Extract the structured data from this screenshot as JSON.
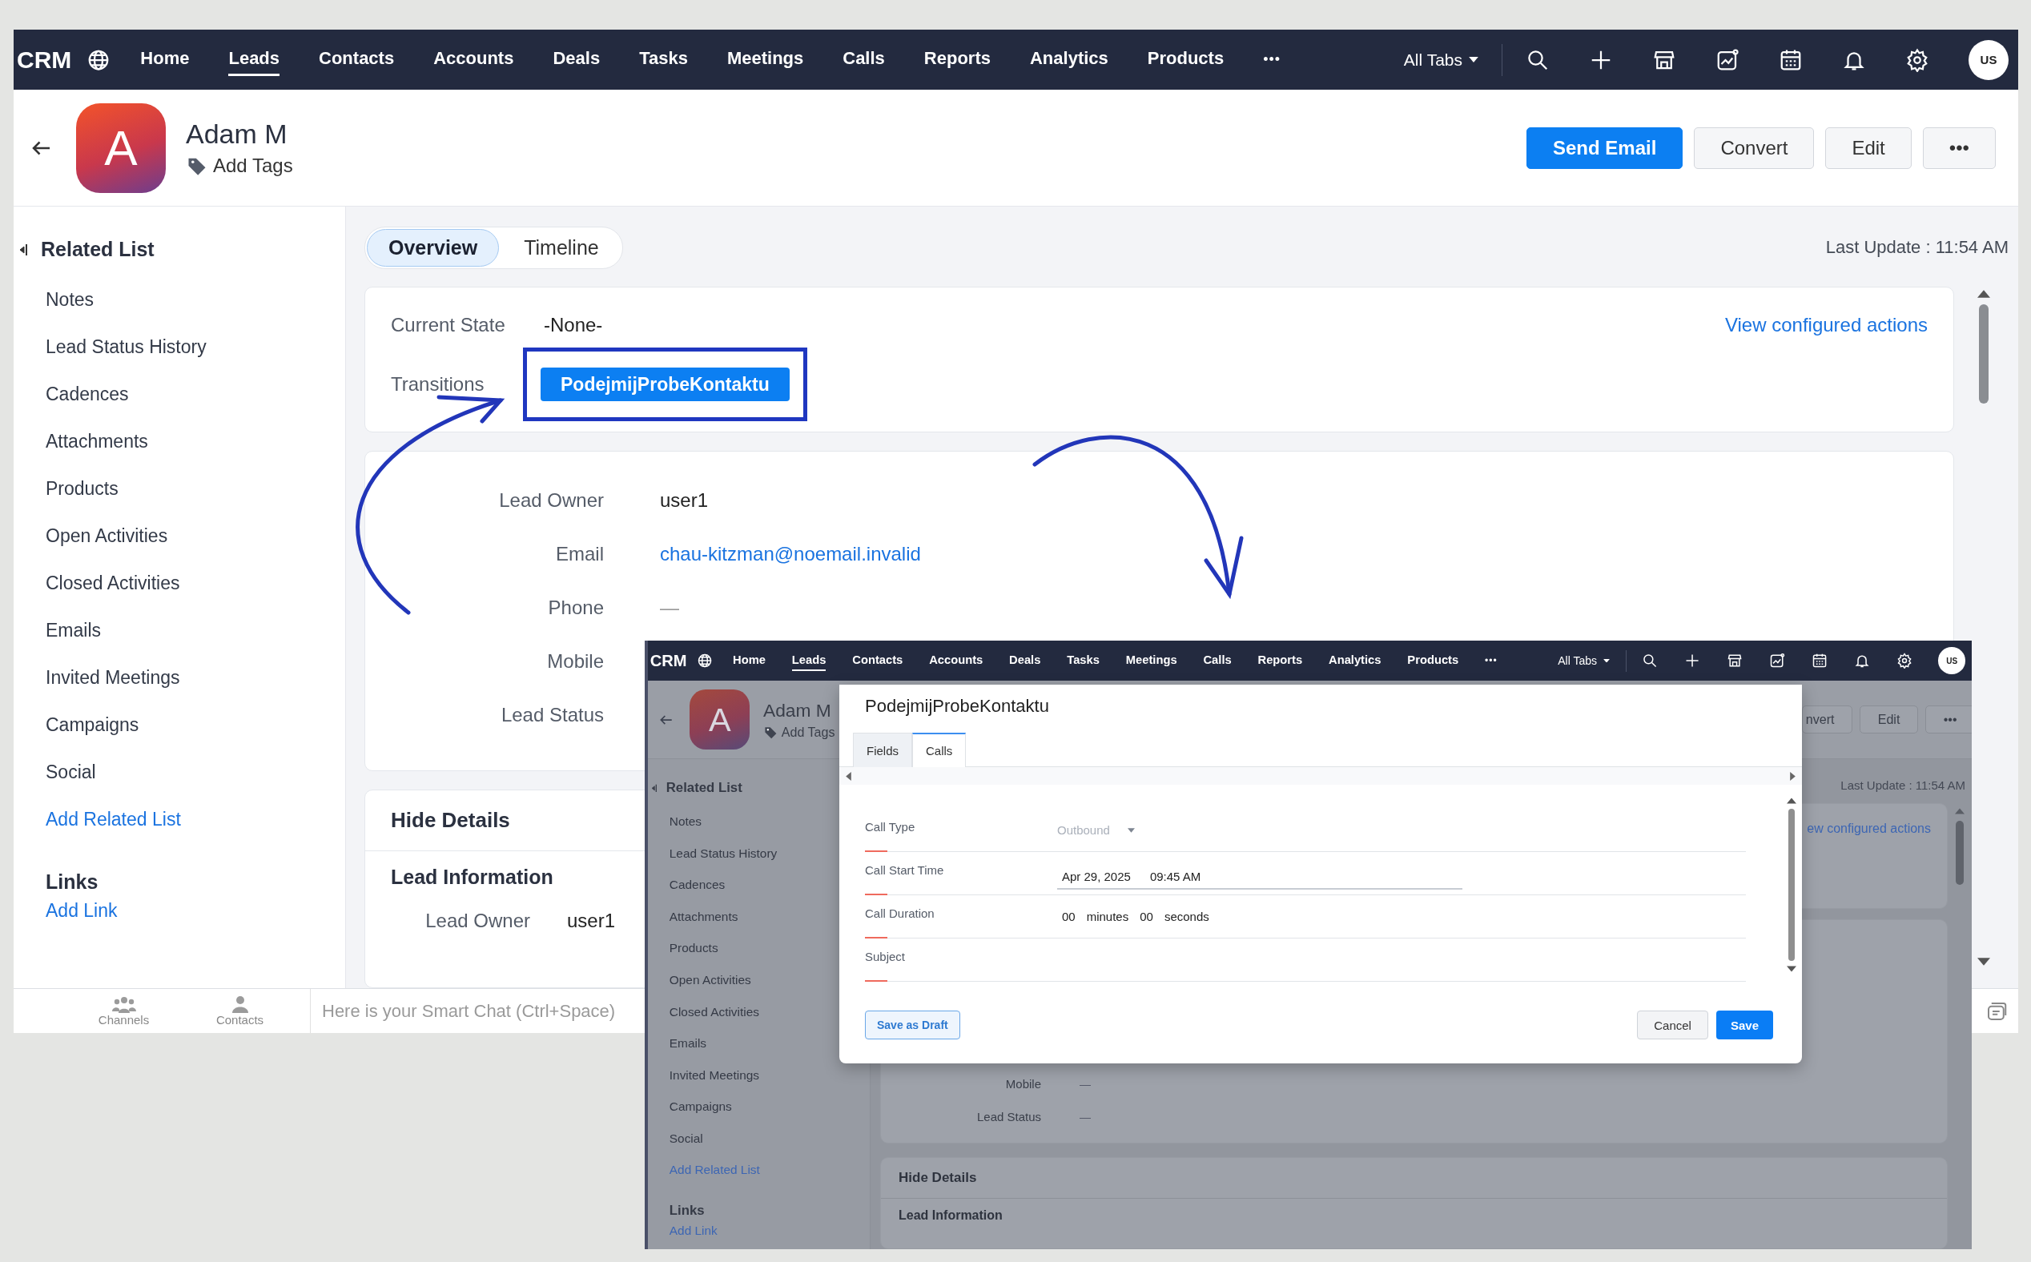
{
  "nav": {
    "logo": "CRM",
    "items": [
      {
        "label": "Home",
        "selected": false
      },
      {
        "label": "Leads",
        "selected": true
      },
      {
        "label": "Contacts",
        "selected": false
      },
      {
        "label": "Accounts",
        "selected": false
      },
      {
        "label": "Deals",
        "selected": false
      },
      {
        "label": "Tasks",
        "selected": false
      },
      {
        "label": "Meetings",
        "selected": false
      },
      {
        "label": "Calls",
        "selected": false
      },
      {
        "label": "Reports",
        "selected": false
      },
      {
        "label": "Analytics",
        "selected": false
      },
      {
        "label": "Products",
        "selected": false
      }
    ],
    "more": "•••",
    "all_tabs": "All Tabs",
    "avatar": "US"
  },
  "record": {
    "initial": "A",
    "name": "Adam M",
    "add_tags": "Add Tags"
  },
  "actions": [
    {
      "label": "Send Email",
      "kind": "primary"
    },
    {
      "label": "Convert",
      "kind": "secondary"
    },
    {
      "label": "Edit",
      "kind": "secondary"
    },
    {
      "label": "•••",
      "kind": "secondary"
    }
  ],
  "sidebar": {
    "title": "Related List",
    "items": [
      {
        "label": "Notes",
        "kind": "item"
      },
      {
        "label": "Lead Status History",
        "kind": "item"
      },
      {
        "label": "Cadences",
        "kind": "item"
      },
      {
        "label": "Attachments",
        "kind": "item"
      },
      {
        "label": "Products",
        "kind": "item"
      },
      {
        "label": "Open Activities",
        "kind": "item"
      },
      {
        "label": "Closed Activities",
        "kind": "item"
      },
      {
        "label": "Emails",
        "kind": "item"
      },
      {
        "label": "Invited Meetings",
        "kind": "item"
      },
      {
        "label": "Campaigns",
        "kind": "item"
      },
      {
        "label": "Social",
        "kind": "item"
      },
      {
        "label": "Add Related List",
        "kind": "link"
      }
    ],
    "links_title": "Links",
    "add_link": "Add Link"
  },
  "view_tabs": [
    {
      "label": "Overview",
      "selected": true
    },
    {
      "label": "Timeline",
      "selected": false
    }
  ],
  "last_update": "Last Update : 11:54 AM",
  "blueprint": {
    "current_state_label": "Current State",
    "current_state": "-None-",
    "view_actions": "View configured actions",
    "transitions_label": "Transitions",
    "transition": "PodejmijProbeKontaktu",
    "highlighted": true
  },
  "details": [
    {
      "label": "Lead Owner",
      "value": "user1",
      "kind": "text"
    },
    {
      "label": "Email",
      "value": "chau-kitzman@noemail.invalid",
      "kind": "link"
    },
    {
      "label": "Phone",
      "value": "—",
      "kind": "empty"
    },
    {
      "label": "Mobile"
    },
    {
      "label": "Lead Status"
    }
  ],
  "hide_details": "Hide Details",
  "lead_information": "Lead Information",
  "info_rows": [
    {
      "label": "Lead Owner",
      "value": "user1"
    }
  ],
  "chat_bar": {
    "tabs": [
      {
        "label": "Channels",
        "kind": "group"
      },
      {
        "label": "Contacts",
        "kind": "person"
      }
    ],
    "placeholder": "Here is your Smart Chat (Ctrl+Space)"
  },
  "inset": {
    "nav": {
      "logo": "CRM",
      "items": [
        {
          "label": "Home",
          "selected": false
        },
        {
          "label": "Leads",
          "selected": true
        },
        {
          "label": "Contacts",
          "selected": false
        },
        {
          "label": "Accounts",
          "selected": false
        },
        {
          "label": "Deals",
          "selected": false
        },
        {
          "label": "Tasks",
          "selected": false
        },
        {
          "label": "Meetings",
          "selected": false
        },
        {
          "label": "Calls",
          "selected": false
        },
        {
          "label": "Reports",
          "selected": false
        },
        {
          "label": "Analytics",
          "selected": false
        },
        {
          "label": "Products",
          "selected": false
        }
      ],
      "more": "•••",
      "all_tabs": "All Tabs",
      "avatar": "US"
    },
    "record": {
      "initial": "A",
      "name": "Adam M",
      "add_tags": "Add Tags"
    },
    "actions": [
      {
        "label": "nvert",
        "kind": "secondary"
      },
      {
        "label": "Edit",
        "kind": "secondary"
      },
      {
        "label": "•••",
        "kind": "secondary"
      }
    ],
    "sidebar": {
      "title": "Related List",
      "items": [
        {
          "label": "Notes",
          "kind": "item"
        },
        {
          "label": "Lead Status History",
          "kind": "item"
        },
        {
          "label": "Cadences",
          "kind": "item"
        },
        {
          "label": "Attachments",
          "kind": "item"
        },
        {
          "label": "Products",
          "kind": "item"
        },
        {
          "label": "Open Activities",
          "kind": "item"
        },
        {
          "label": "Closed Activities",
          "kind": "item"
        },
        {
          "label": "Emails",
          "kind": "item"
        },
        {
          "label": "Invited Meetings",
          "kind": "item"
        },
        {
          "label": "Campaigns",
          "kind": "item"
        },
        {
          "label": "Social",
          "kind": "item"
        },
        {
          "label": "Add Related List",
          "kind": "link"
        }
      ],
      "links_title": "Links",
      "add_link": "Add Link"
    },
    "last_update": "Last Update : 11:54 AM",
    "view_actions": "ew configured actions",
    "details": [
      {
        "label": "Mobile",
        "value": "—"
      },
      {
        "label": "Lead Status",
        "value": "—"
      }
    ],
    "hide_details": "Hide Details",
    "lead_information": "Lead Information",
    "dialog": {
      "title": "PodejmijProbeKontaktu",
      "tabs": [
        {
          "label": "Fields",
          "selected": false
        },
        {
          "label": "Calls",
          "selected": true
        }
      ],
      "fields": [
        {
          "label": "Call Type",
          "kind": "select",
          "required": true,
          "placeholder": "Outbound"
        },
        {
          "label": "Call Start Time",
          "kind": "datetime",
          "required": true,
          "date": "Apr 29, 2025",
          "time": "09:45 AM"
        },
        {
          "label": "Call Duration",
          "kind": "duration",
          "required": true,
          "minutes": "00",
          "minutes_unit": "minutes",
          "seconds": "00",
          "seconds_unit": "seconds"
        },
        {
          "label": "Subject",
          "kind": "text",
          "required": true
        }
      ],
      "draft": "Save as Draft",
      "cancel": "Cancel",
      "save": "Save"
    }
  }
}
